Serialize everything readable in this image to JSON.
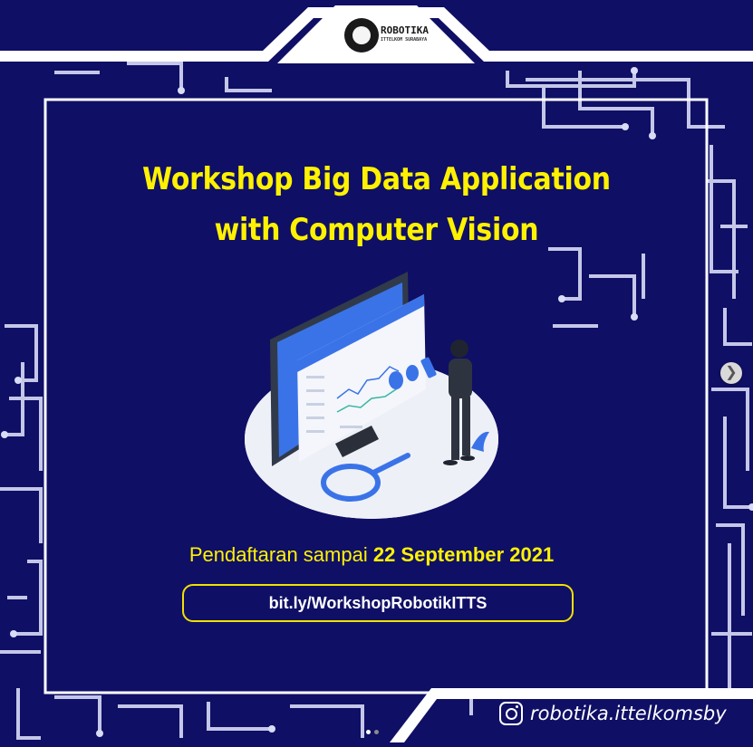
{
  "header": {
    "logo_text": "ROBOTIKA",
    "logo_sub": "ITTELKOM SURABAYA"
  },
  "poster": {
    "title_line1": "Workshop Big Data Application",
    "title_line2": "with Computer Vision",
    "registration_prefix": "Pendaftaran sampai",
    "registration_date": "22 September 2021",
    "link": "bit.ly/WorkshopRobotikITTS"
  },
  "footer": {
    "instagram_handle": "robotika.ittelkomsby"
  },
  "carousel": {
    "next_icon": "chevron-right-icon",
    "pages": 2,
    "current": 1
  },
  "colors": {
    "background": "#0f0f66",
    "accent": "#fff200",
    "frame": "#ffffff"
  }
}
